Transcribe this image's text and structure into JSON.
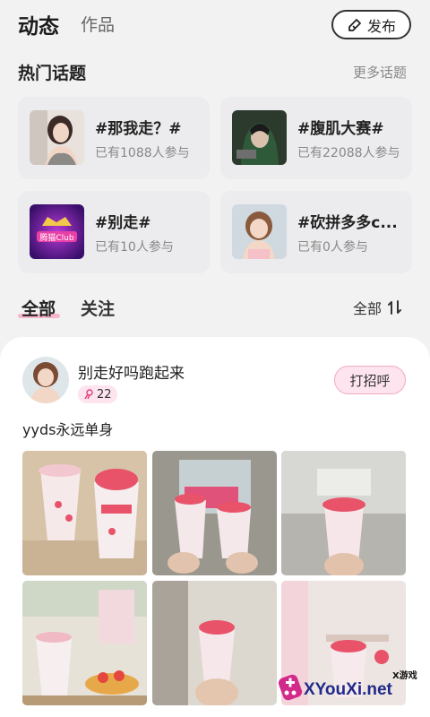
{
  "header": {
    "tab_active": "动态",
    "tab_inactive": "作品",
    "publish_label": "发布"
  },
  "hot_topics": {
    "title": "热门话题",
    "more_label": "更多话题",
    "items": [
      {
        "name": "#那我走？#",
        "count": "已有1088人参与"
      },
      {
        "name": "#腹肌大赛#",
        "count": "已有22088人参与"
      },
      {
        "name": "#别走#",
        "count": "已有10人参与"
      },
      {
        "name": "#砍拼多多c...",
        "count": "已有0人参与"
      }
    ],
    "thumb3_text": "腾猫Club"
  },
  "filter": {
    "all_label": "全部",
    "follow_label": "关注",
    "sort_label": "全部"
  },
  "post": {
    "username": "别走好吗跑起来",
    "badge_count": "22",
    "greet_label": "打招呼",
    "text": "yyds永远单身"
  },
  "watermark": {
    "text": "XYouXi.net",
    "small": "X游戏"
  },
  "colors": {
    "accent_pink": "#f7b6cc",
    "badge_bg": "#fde4ee",
    "card_bg": "#ececee"
  }
}
